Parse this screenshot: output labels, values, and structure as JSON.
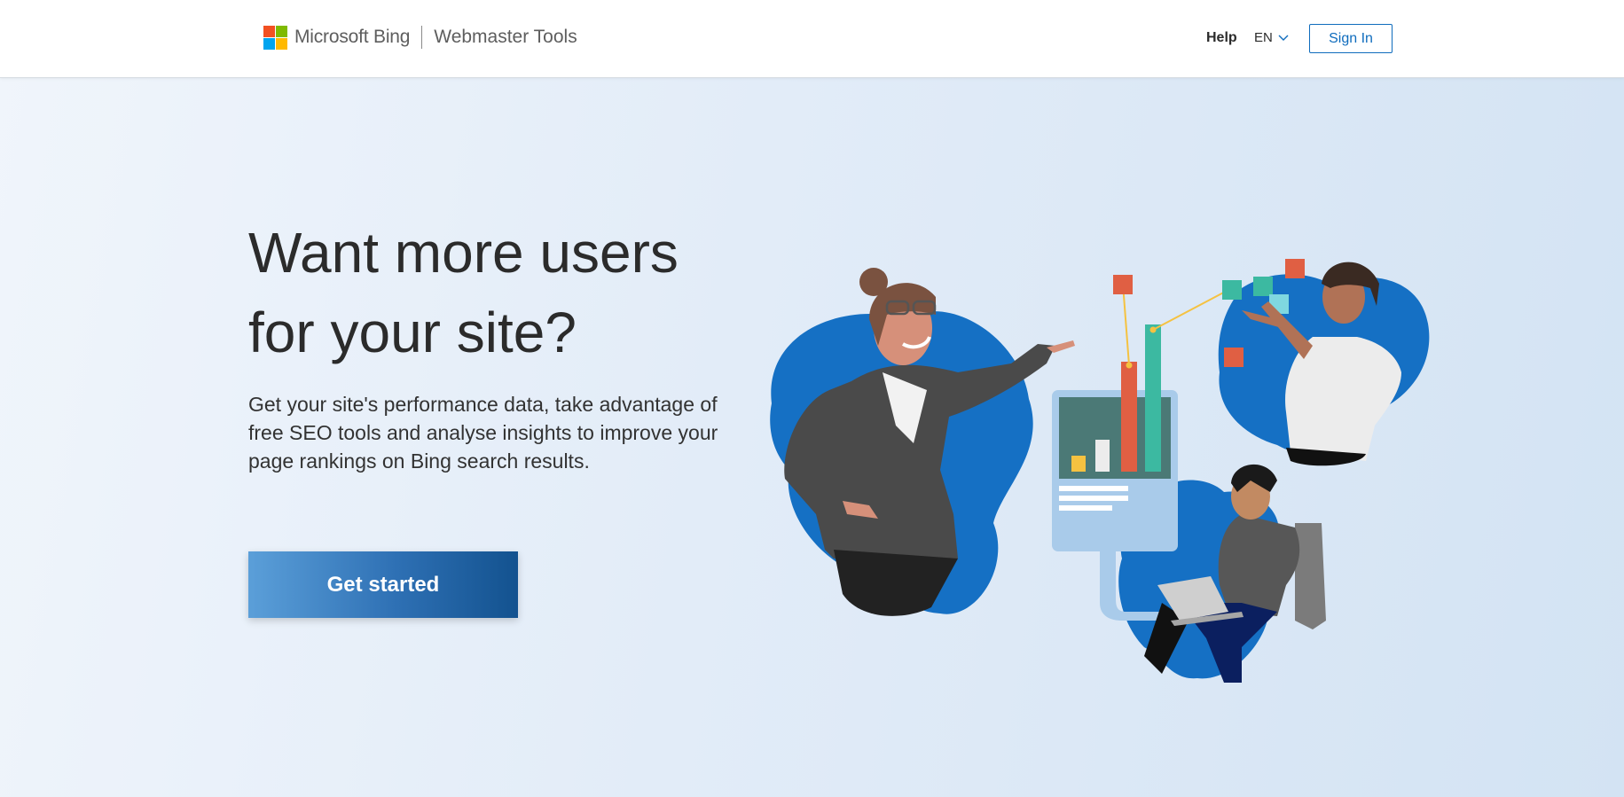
{
  "header": {
    "brand_name": "Microsoft Bing",
    "product_name": "Webmaster Tools",
    "help_label": "Help",
    "language_label": "EN",
    "signin_label": "Sign In"
  },
  "hero": {
    "title_line1": "Want more users",
    "title_line2": "for your site?",
    "description": "Get your site's performance data, take advantage of free SEO tools and analyse insights to improve your page rankings on Bing search results.",
    "cta_label": "Get started"
  },
  "colors": {
    "accent": "#0f6cbd",
    "cta_start": "#5b9fd9",
    "cta_end": "#13528f",
    "illustration_blue": "#1570c4"
  }
}
